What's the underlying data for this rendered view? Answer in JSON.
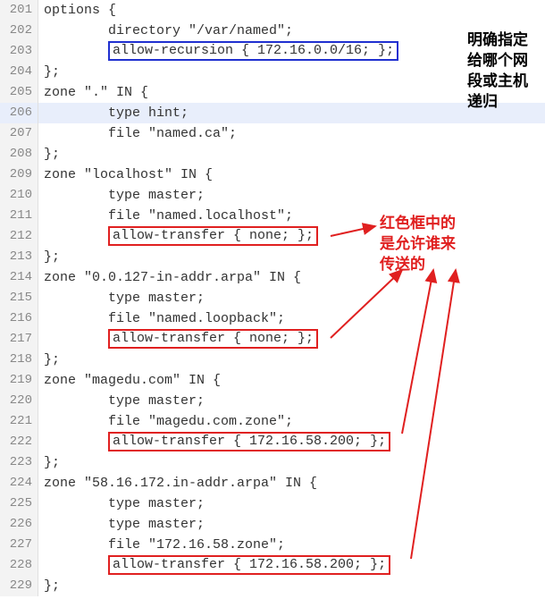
{
  "lines": [
    {
      "num": "201",
      "text": "options {"
    },
    {
      "num": "202",
      "text": "        directory \"/var/named\";"
    },
    {
      "num": "203",
      "text": "        ",
      "box": "blue",
      "boxText": "allow-recursion { 172.16.0.0/16; };"
    },
    {
      "num": "204",
      "text": "};"
    },
    {
      "num": "205",
      "text": "zone \".\" IN {"
    },
    {
      "num": "206",
      "text": "        type hint;",
      "highlight": true
    },
    {
      "num": "207",
      "text": "        file \"named.ca\";"
    },
    {
      "num": "208",
      "text": "};"
    },
    {
      "num": "209",
      "text": "zone \"localhost\" IN {"
    },
    {
      "num": "210",
      "text": "        type master;"
    },
    {
      "num": "211",
      "text": "        file \"named.localhost\";"
    },
    {
      "num": "212",
      "text": "        ",
      "box": "red",
      "boxText": "allow-transfer { none; };"
    },
    {
      "num": "213",
      "text": "};"
    },
    {
      "num": "214",
      "text": "zone \"0.0.127-in-addr.arpa\" IN {"
    },
    {
      "num": "215",
      "text": "        type master;"
    },
    {
      "num": "216",
      "text": "        file \"named.loopback\";"
    },
    {
      "num": "217",
      "text": "        ",
      "box": "red",
      "boxText": "allow-transfer { none; };"
    },
    {
      "num": "218",
      "text": "};"
    },
    {
      "num": "219",
      "text": "zone \"magedu.com\" IN {"
    },
    {
      "num": "220",
      "text": "        type master;"
    },
    {
      "num": "221",
      "text": "        file \"magedu.com.zone\";"
    },
    {
      "num": "222",
      "text": "        ",
      "box": "red",
      "boxText": "allow-transfer { 172.16.58.200; };"
    },
    {
      "num": "223",
      "text": "};"
    },
    {
      "num": "224",
      "text": "zone \"58.16.172.in-addr.arpa\" IN {"
    },
    {
      "num": "225",
      "text": "        type master;"
    },
    {
      "num": "226",
      "text": "        type master;"
    },
    {
      "num": "227",
      "text": "        file \"172.16.58.zone\";"
    },
    {
      "num": "228",
      "text": "        ",
      "box": "red",
      "boxText": "allow-transfer { 172.16.58.200; };"
    },
    {
      "num": "229",
      "text": "};"
    }
  ],
  "annotations": {
    "blue1": "明确指定",
    "blue2": "给哪个网",
    "blue3": "段或主机",
    "blue4": "递归",
    "red1": "红色框中的",
    "red2": "是允许谁来",
    "red3": "传送的"
  },
  "colors": {
    "blueBox": "#2030d0",
    "redBox": "#e02020",
    "arrow": "#e02020"
  }
}
